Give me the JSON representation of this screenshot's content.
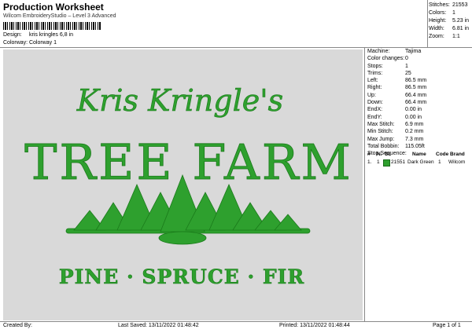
{
  "header": {
    "title": "Production Worksheet",
    "subtitle": "Wilcom EmbroideryStudio – Level 3 Advanced",
    "barcode_text": "*kris kringles 6,8 in*"
  },
  "meta": [
    {
      "key": "Design:",
      "value": "kris kringles 6,8 in"
    },
    {
      "key": "Colorway:",
      "value": "Colorway 1"
    }
  ],
  "top_stats": [
    {
      "key": "Stitches:",
      "value": "21553"
    },
    {
      "key": "Colors:",
      "value": "1"
    },
    {
      "key": "Height:",
      "value": "5.23 in"
    },
    {
      "key": "Width:",
      "value": "6.81 in"
    },
    {
      "key": "Zoom:",
      "value": "1:1"
    }
  ],
  "machine_info": [
    {
      "key": "Machine:",
      "value": "Tajima"
    },
    {
      "key": "Color changes:",
      "value": "0"
    },
    {
      "key": "Stops:",
      "value": "1"
    },
    {
      "key": "Trims:",
      "value": "25"
    },
    {
      "key": "Left:",
      "value": "86.5 mm"
    },
    {
      "key": "Right:",
      "value": "86.5 mm"
    },
    {
      "key": "Up:",
      "value": "66.4 mm"
    },
    {
      "key": "Down:",
      "value": "66.4 mm"
    },
    {
      "key": "EndX:",
      "value": "0.00 in"
    },
    {
      "key": "EndY:",
      "value": "0.00 in"
    },
    {
      "key": "Max Stitch:",
      "value": "6.9 mm"
    },
    {
      "key": "Min Stitch:",
      "value": "0.2 mm"
    },
    {
      "key": "Max Jump:",
      "value": "7.3 mm"
    },
    {
      "key": "Total Bobbin:",
      "value": "115.05ft"
    }
  ],
  "stop_sequence": {
    "title": "Stop Sequence:",
    "columns": [
      "#",
      "N.",
      "St.",
      "Name",
      "Code",
      "Brand"
    ],
    "rows": [
      {
        "num": "1.",
        "n": "1",
        "st": "21551",
        "name": "Dark Green",
        "code": "1",
        "brand": "Wilcom"
      }
    ]
  },
  "design_text": {
    "line1": "Kris Kringle's",
    "line2": "TREE FARM",
    "line3": "PINE · SPRUCE · FIR"
  },
  "colors": {
    "thread": "#2ea02e",
    "thread_dark": "#1a7a1a",
    "preview_bg": "#d9d9d9"
  },
  "footer": {
    "created_by": "Created By:",
    "last_saved": "Last Saved: 13/11/2022 01:48:42",
    "printed": "Printed: 13/11/2022 01:48:44",
    "page": "Page 1 of 1"
  }
}
